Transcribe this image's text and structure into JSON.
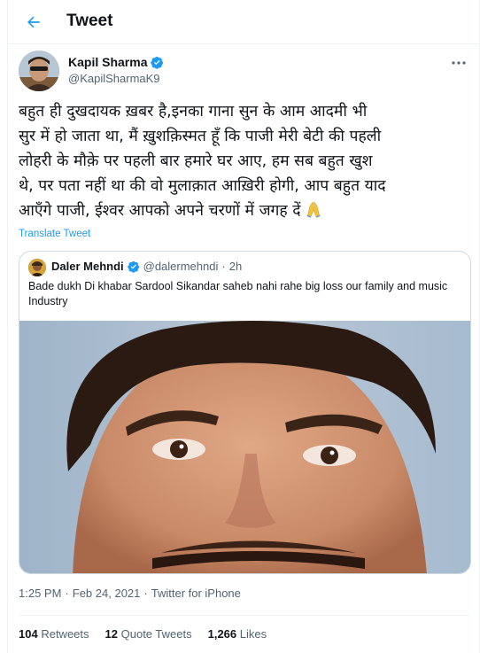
{
  "header": {
    "title": "Tweet"
  },
  "colors": {
    "accent": "#1d9bf0",
    "text": "#0f1419",
    "secondary": "#536471",
    "border": "#cfd9de"
  },
  "author": {
    "name": "Kapil Sharma",
    "handle": "@KapilSharmaK9",
    "verified": true
  },
  "tweet": {
    "text": "बहुत ही दुखदायक ख़बर है,इनका गाना सुन के आम आदमी भी\nसुर में हो जाता था, मैं ख़ुशक़िस्मत हूँ कि पाजी मेरी बेटी की पहली\nलोहरी के मौक़े पर पहली बार हमारे घर आए, हम सब बहुत खुश\nथे, पर पता नहीं था की वो मुलाक़ात आख़िरी होगी, आप बहुत याद\nआएँगे पाजी, ईश्वर आपको अपने चरणों में जगह दें",
    "emoji": "folded-hands-icon",
    "translate_label": "Translate Tweet"
  },
  "quote": {
    "name": "Daler Mehndi",
    "handle": "@dalermehndi",
    "separator": "·",
    "time": "2h",
    "verified": true,
    "text": "Bade dukh Di khabar Sardool Sikandar saheb nahi rahe big loss our family and music Industry"
  },
  "meta": {
    "time": "1:25 PM",
    "separator": "·",
    "date": "Feb 24, 2021",
    "source": "Twitter for iPhone"
  },
  "stats": [
    {
      "count": "104",
      "label": "Retweets"
    },
    {
      "count": "12",
      "label": "Quote Tweets"
    },
    {
      "count": "1,266",
      "label": "Likes"
    }
  ]
}
